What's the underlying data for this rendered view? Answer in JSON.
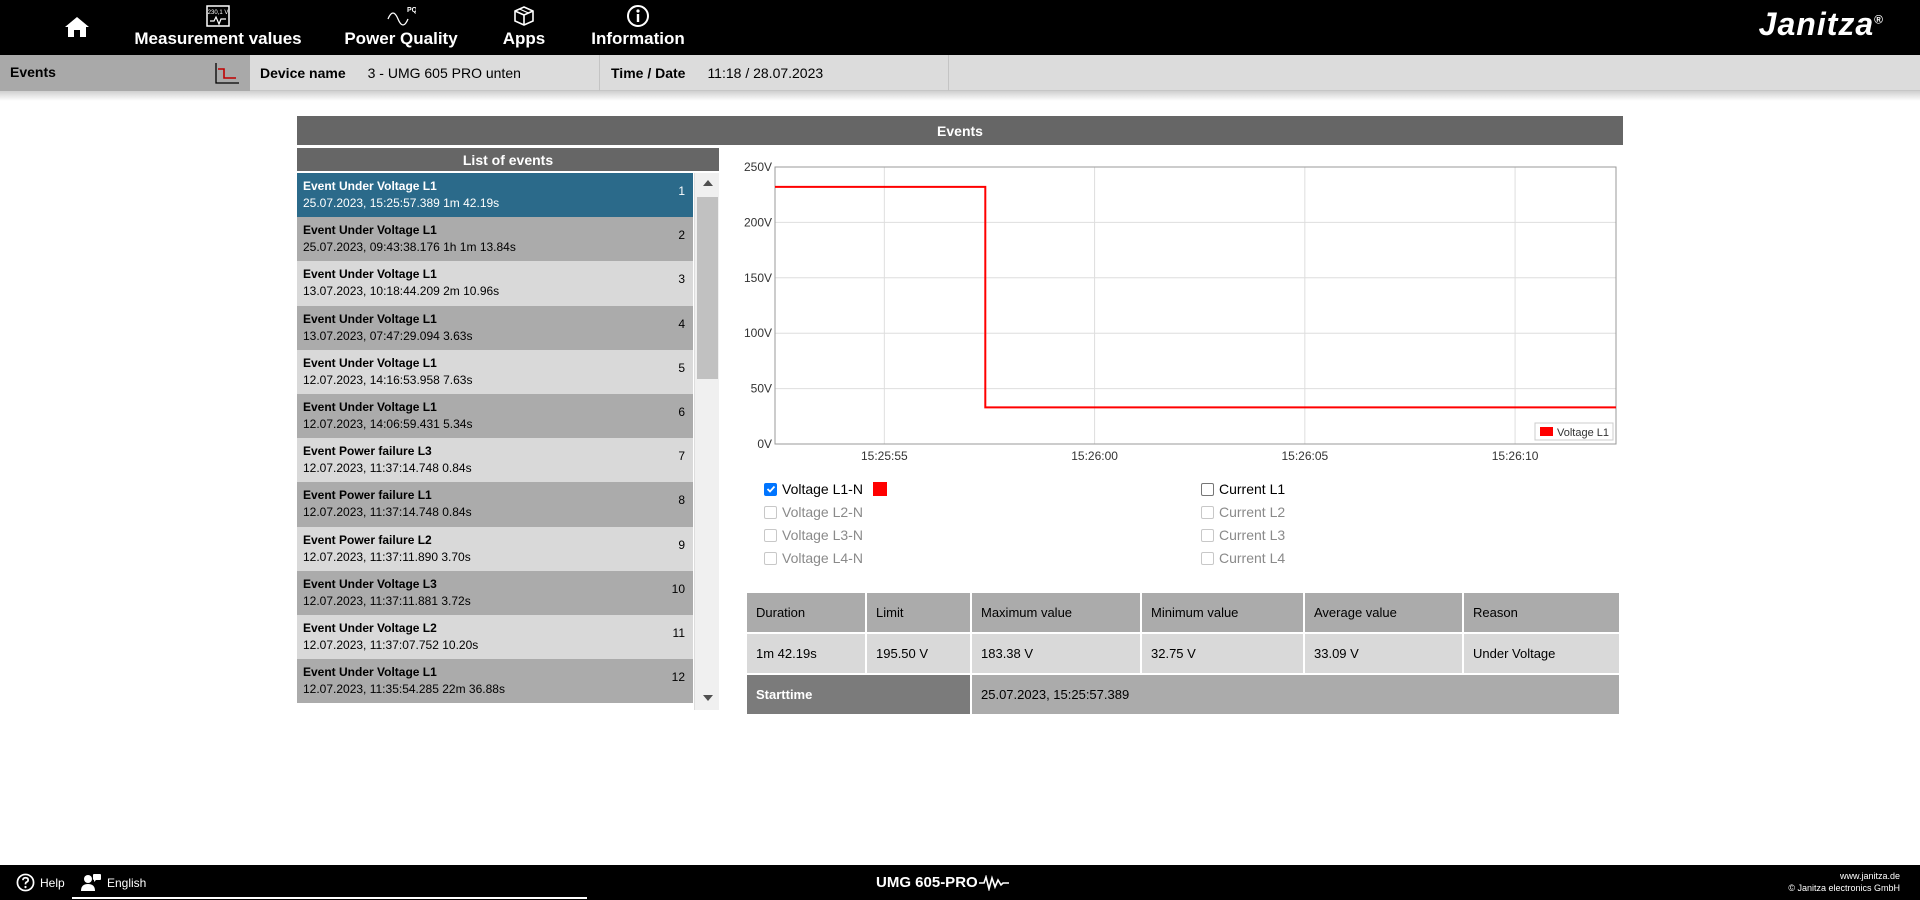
{
  "nav": {
    "items": [
      {
        "label": "Measurement values",
        "icon": "meter-icon",
        "icon_text": "230,1 V"
      },
      {
        "label": "Power Quality",
        "icon": "power-quality-icon",
        "icon_text": "PQ"
      },
      {
        "label": "Apps",
        "icon": "apps-box-icon"
      },
      {
        "label": "Information",
        "icon": "info-icon"
      }
    ],
    "brand": "Janitza",
    "brand_mark": "®"
  },
  "infobar": {
    "section": "Events",
    "device_label": "Device name",
    "device_value": "3 - UMG 605 PRO unten",
    "time_label": "Time / Date",
    "time_value": "11:18 / 28.07.2023"
  },
  "panel": {
    "title": "Events",
    "list_title": "List of events"
  },
  "events": [
    {
      "title": "Event Under Voltage L1",
      "detail": "25.07.2023, 15:25:57.389 1m 42.19s",
      "num": "1"
    },
    {
      "title": "Event Under Voltage L1",
      "detail": "25.07.2023, 09:43:38.176 1h 1m 13.84s",
      "num": "2"
    },
    {
      "title": "Event Under Voltage L1",
      "detail": "13.07.2023, 10:18:44.209 2m 10.96s",
      "num": "3"
    },
    {
      "title": "Event Under Voltage L1",
      "detail": "13.07.2023, 07:47:29.094 3.63s",
      "num": "4"
    },
    {
      "title": "Event Under Voltage L1",
      "detail": "12.07.2023, 14:16:53.958 7.63s",
      "num": "5"
    },
    {
      "title": "Event Under Voltage L1",
      "detail": "12.07.2023, 14:06:59.431 5.34s",
      "num": "6"
    },
    {
      "title": "Event Power failure L3",
      "detail": "12.07.2023, 11:37:14.748 0.84s",
      "num": "7"
    },
    {
      "title": "Event Power failure L1",
      "detail": "12.07.2023, 11:37:14.748 0.84s",
      "num": "8"
    },
    {
      "title": "Event Power failure L2",
      "detail": "12.07.2023, 11:37:11.890 3.70s",
      "num": "9"
    },
    {
      "title": "Event Under Voltage L3",
      "detail": "12.07.2023, 11:37:11.881 3.72s",
      "num": "10"
    },
    {
      "title": "Event Under Voltage L2",
      "detail": "12.07.2023, 11:37:07.752 10.20s",
      "num": "11"
    },
    {
      "title": "Event Under Voltage L1",
      "detail": "12.07.2023, 11:35:54.285 22m 36.88s",
      "num": "12"
    }
  ],
  "chart_data": {
    "type": "line",
    "y_tick_labels": [
      "0V",
      "50V",
      "100V",
      "150V",
      "200V",
      "250V"
    ],
    "y_ticks": [
      0,
      50,
      100,
      150,
      200,
      250
    ],
    "ylim": [
      0,
      250
    ],
    "x_tick_labels": [
      "15:25:55",
      "15:26:00",
      "15:26:05",
      "15:26:10"
    ],
    "x_ticks": [
      0,
      5,
      10,
      15
    ],
    "xlim": [
      -2.6,
      17.4
    ],
    "grid": true,
    "legend_position": "bottom-right",
    "series": [
      {
        "name": "Voltage L1",
        "color": "#ff0000",
        "step": true,
        "x": [
          -2.6,
          2.4,
          2.4,
          17.4
        ],
        "y": [
          232,
          232,
          33,
          33
        ]
      }
    ]
  },
  "checkboxes": {
    "left": [
      {
        "label": "Voltage L1-N",
        "checked": true,
        "disabled": false,
        "swatch": "#ff0000"
      },
      {
        "label": "Voltage L2-N",
        "checked": false,
        "disabled": true
      },
      {
        "label": "Voltage L3-N",
        "checked": false,
        "disabled": true
      },
      {
        "label": "Voltage L4-N",
        "checked": false,
        "disabled": true
      }
    ],
    "right": [
      {
        "label": "Current L1",
        "checked": false,
        "disabled": false
      },
      {
        "label": "Current L2",
        "checked": false,
        "disabled": true
      },
      {
        "label": "Current L3",
        "checked": false,
        "disabled": true
      },
      {
        "label": "Current L4",
        "checked": false,
        "disabled": true
      }
    ]
  },
  "stats": {
    "headers": [
      "Duration",
      "Limit",
      "Maximum value",
      "Minimum value",
      "Average value",
      "Reason"
    ],
    "values": [
      "1m 42.19s",
      "195.50 V",
      "183.38 V",
      "32.75 V",
      "33.09 V",
      "Under Voltage"
    ],
    "start_label": "Starttime",
    "start_value": "25.07.2023, 15:25:57.389"
  },
  "footer": {
    "help": "Help",
    "language": "English",
    "model": "UMG 605-PRO",
    "site": "www.janitza.de",
    "copyright": "© Janitza electronics GmbH"
  }
}
